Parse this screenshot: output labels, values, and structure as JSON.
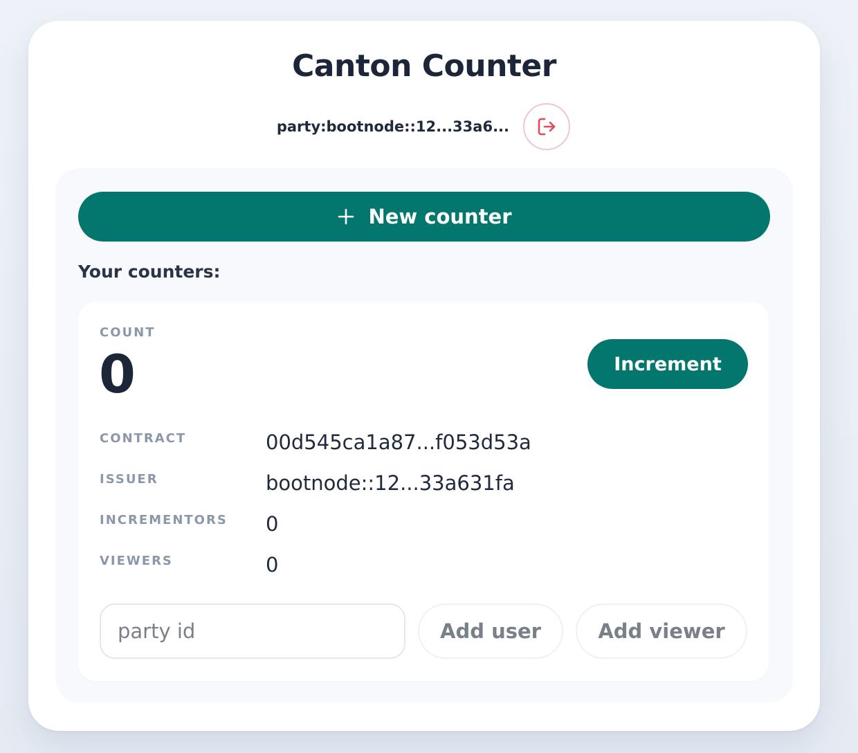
{
  "app": {
    "title": "Canton Counter",
    "party_id": "party:bootnode::12...33a6..."
  },
  "actions": {
    "new_counter_label": "New counter"
  },
  "counters_section": {
    "label": "Your counters:"
  },
  "counter": {
    "count_label": "COUNT",
    "count_value": "0",
    "increment_label": "Increment",
    "fields": [
      {
        "key": "CONTRACT",
        "value": "00d545ca1a87...f053d53a"
      },
      {
        "key": "ISSUER",
        "value": "bootnode::12...33a631fa"
      },
      {
        "key": "INCREMENTORS",
        "value": "0"
      },
      {
        "key": "VIEWERS",
        "value": "0"
      }
    ],
    "party_input": {
      "value": "",
      "placeholder": "party id"
    },
    "add_user_label": "Add user",
    "add_viewer_label": "Add viewer"
  },
  "icons": {
    "logout": "logout-icon",
    "plus": "plus-icon"
  },
  "colors": {
    "accent": "#03776d",
    "logout": "#e24a5a",
    "text": "#1d2638",
    "muted_label": "#8b97aa"
  }
}
